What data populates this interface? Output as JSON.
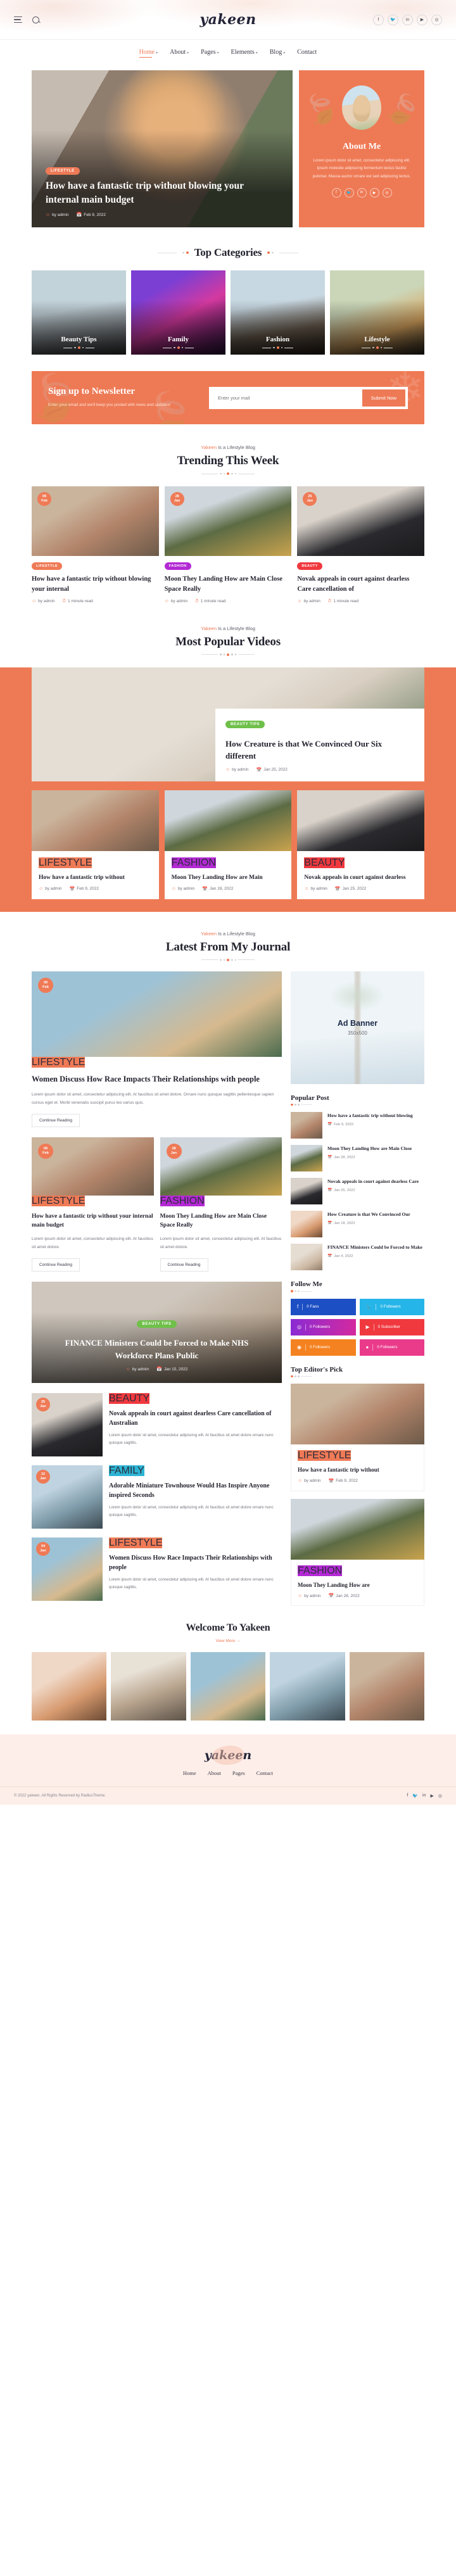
{
  "brand": {
    "logo": "yakeen",
    "accent": "#ee7a55"
  },
  "header": {
    "menu_icon": "hamburger-icon",
    "search_icon": "search-icon",
    "socials": [
      "f",
      "t",
      "in",
      "yt",
      "ig"
    ],
    "nav": [
      {
        "label": "Home",
        "caret": "▾",
        "active": true
      },
      {
        "label": "About",
        "caret": "▾",
        "active": false
      },
      {
        "label": "Pages",
        "caret": "▾",
        "active": false
      },
      {
        "label": "Elements",
        "caret": "▾",
        "active": false
      },
      {
        "label": "Blog",
        "caret": "▾",
        "active": false
      },
      {
        "label": "Contact",
        "caret": "",
        "active": false
      }
    ]
  },
  "hero": {
    "category": "LIFESTYLE",
    "title": "How have a fantastic trip without blowing your internal main budget",
    "author": "by admin",
    "date": "Feb 9, 2022"
  },
  "about": {
    "heading": "About Me",
    "text": "Lorem ipsum dolor sit amet, consectetur adipiscing elit. Ipsum molestie adipiscing fermentum lectus facilisi pulvinar. Massa auctor ornare est sed adipiscing lectus.",
    "socials": [
      "f",
      "t",
      "in",
      "yt",
      "ig"
    ]
  },
  "categories": {
    "heading": "Top Categories",
    "items": [
      {
        "label": "Beauty Tips"
      },
      {
        "label": "Family"
      },
      {
        "label": "Fashion"
      },
      {
        "label": "Lifestyle"
      }
    ]
  },
  "newsletter": {
    "heading": "Sign up to Newsletter",
    "text": "Enter your email and we'll keep you posted with news and updates!",
    "placeholder": "Enter your mail",
    "button": "Submit Now"
  },
  "trending": {
    "eyebrow_brand": "Yakeen",
    "eyebrow_rest": " Is a Lifestyle Blog",
    "heading": "Trending This Week",
    "posts": [
      {
        "day": "09",
        "month": "Feb",
        "tag": "LIFESTYLE",
        "tag_color": "#ef7a56",
        "title": "How have a fantastic trip without blowing your internal",
        "author": "by admin",
        "read": "1 minute read"
      },
      {
        "day": "28",
        "month": "Jan",
        "tag": "FASHION",
        "tag_color": "#b32ad4",
        "title": "Moon They Landing How are Main Close Space Really",
        "author": "by admin",
        "read": "1 minute read"
      },
      {
        "day": "25",
        "month": "Jan",
        "tag": "BEAUTY",
        "tag_color": "#f0393f",
        "title": "Novak appeals in court against dearless Care cancellation of",
        "author": "by admin",
        "read": "1 minute read"
      }
    ]
  },
  "videos": {
    "eyebrow_brand": "Yakeen",
    "eyebrow_rest": " Is a Lifestyle Blog",
    "heading": "Most Popular Videos",
    "feature": {
      "tag": "BEAUTY TIPS",
      "tag_color": "#6fc04a",
      "title": "How Creature is that We Convinced Our Six different",
      "author": "by admin",
      "date": "Jan 25, 2022"
    },
    "cards": [
      {
        "tag": "LIFESTYLE",
        "tag_color": "#ef7a56",
        "title": "How have a fantastic trip without",
        "author": "by admin",
        "date": "Feb 9, 2022"
      },
      {
        "tag": "FASHION",
        "tag_color": "#b32ad4",
        "title": "Moon They Landing How are Main",
        "author": "by admin",
        "date": "Jan 28, 2022"
      },
      {
        "tag": "BEAUTY",
        "tag_color": "#f0393f",
        "title": "Novak appeals in court against dearless",
        "author": "by admin",
        "date": "Jan 25, 2022"
      }
    ]
  },
  "journal": {
    "eyebrow_brand": "Yakeen",
    "eyebrow_rest": " Is a Lifestyle Blog",
    "heading": "Latest From My Journal",
    "lead": {
      "day": "09",
      "month": "Feb",
      "tag": "LIFESTYLE",
      "tag_color": "#ef7a56",
      "title": "Women Discuss How Race Impacts Their Relationships with people",
      "excerpt": "Lorem ipsum dolor sit amet, consectetur adipiscing elit. At faucibus sit amet dolore. Ornare nunc quisque sagittis pellentesque sapien cursus eget et. Morbi venenatis suscipit purus leo varius quis.",
      "button": "Continue Reading"
    },
    "pair": [
      {
        "day": "09",
        "month": "Feb",
        "tag": "LIFESTYLE",
        "tag_color": "#ef7a56",
        "title": "How have a fantastic trip without your internal main budget",
        "excerpt": "Lorem ipsum dolor sit amet, consectetur adipiscing elit. At faucibus sit amet dolore.",
        "button": "Continue Reading"
      },
      {
        "day": "28",
        "month": "Jan",
        "tag": "FASHION",
        "tag_color": "#b32ad4",
        "title": "Moon They Landing How are Main Close Space Really",
        "excerpt": "Lorem ipsum dolor sit amet, consectetur adipiscing elit. At faucibus sit amet dolore.",
        "button": "Continue Reading"
      }
    ],
    "feature": {
      "tag": "BEAUTY TIPS",
      "tag_color": "#6fc04a",
      "title": "FINANCE Ministers Could be Forced to Make NHS Workforce Plans Public",
      "author": "by admin",
      "date": "Jan 15, 2022"
    },
    "rows": [
      {
        "day": "25",
        "month": "Jan",
        "tag": "BEAUTY",
        "tag_color": "#f0393f",
        "title": "Novak appeals in court against dearless Care cancellation of Australian",
        "excerpt": "Lorem ipsum dolor sit amet, consectetur adipiscing elit. At faucibus sit amet dolore ornare nunc quisque sagittis."
      },
      {
        "day": "12",
        "month": "Jan",
        "tag": "FAMILY",
        "tag_color": "#2cb4d4",
        "title": "Adorable Miniature Townhouse Would Has Inspire Anyone inspired Seconds",
        "excerpt": "Lorem ipsum dolor sit amet, consectetur adipiscing elit. At faucibus sit amet dolore ornare nunc quisque sagittis."
      },
      {
        "day": "04",
        "month": "Jan",
        "tag": "LIFESTYLE",
        "tag_color": "#ef7a56",
        "title": "Women Discuss How Race Impacts Their Relationships with people",
        "excerpt": "Lorem ipsum dolor sit amet, consectetur adipiscing elit. At faucibus sit amet dolore ornare nunc quisque sagittis."
      }
    ]
  },
  "sidebar": {
    "ad": {
      "title": "Ad Banner",
      "size": "350x500"
    },
    "popular_heading": "Popular Post",
    "popular": [
      {
        "title": "How have a fantastic trip without blowing",
        "date": "Feb 9, 2022"
      },
      {
        "title": "Moon They Landing How are Main Close",
        "date": "Jan 28, 2022"
      },
      {
        "title": "Novak appeals in court against dearless Care",
        "date": "Jan 25, 2022"
      },
      {
        "title": "How Creature is that We Convinced Our",
        "date": "Jan 18, 2022"
      },
      {
        "title": "FINANCE Ministers Could be Forced to Make",
        "date": "Jan 4, 2022"
      }
    ],
    "follow_heading": "Follow Me",
    "follow": [
      {
        "icon": "facebook-icon",
        "glyph": "f",
        "label": "0 Fans",
        "color": "#1d4fc4"
      },
      {
        "icon": "twitter-icon",
        "glyph": "t",
        "label": "0 Followers",
        "color": "#26b5e8"
      },
      {
        "icon": "instagram-icon",
        "glyph": "ig",
        "label": "0 Followers",
        "color": "#b62ec4"
      },
      {
        "icon": "youtube-icon",
        "glyph": "yt",
        "label": "0 Subscriber",
        "color": "#f0393f"
      },
      {
        "icon": "rss-icon",
        "glyph": "rs",
        "label": "0 Followers",
        "color": "#f58220"
      },
      {
        "icon": "dribbble-icon",
        "glyph": "db",
        "label": "0 Followers",
        "color": "#ea3b8b"
      }
    ],
    "editors_heading": "Top Editor's Pick",
    "editors": [
      {
        "tag": "LIFESTYLE",
        "tag_color": "#ef7a56",
        "title": "How have a fantastic trip without",
        "author": "by admin",
        "date": "Feb 9, 2022"
      },
      {
        "tag": "FASHION",
        "tag_color": "#b32ad4",
        "title": "Moon They Landing How are",
        "author": "by admin",
        "date": "Jan 28, 2022"
      }
    ]
  },
  "welcome": {
    "heading": "Welcome To Yakeen",
    "more": "View More →"
  },
  "footer": {
    "logo": "yakeen",
    "nav": [
      "Home",
      "About",
      "Pages",
      "Contact"
    ],
    "copyright": "© 2022 yakeen. All Rights Reserved by RadiusTheme.",
    "socials": [
      "f",
      "t",
      "in",
      "yt",
      "ig"
    ]
  }
}
